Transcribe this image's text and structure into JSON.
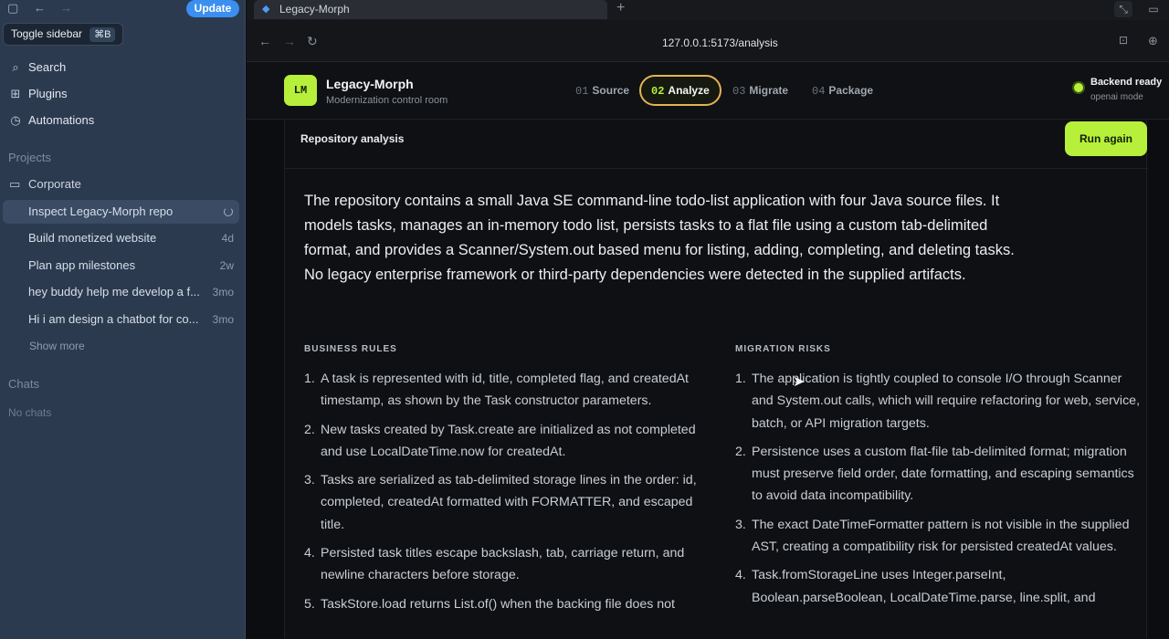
{
  "sidebar": {
    "update_label": "Update",
    "tooltip": {
      "label": "Toggle sidebar",
      "shortcut": "⌘B"
    },
    "nav": [
      {
        "icon": "search-icon",
        "label": "Search"
      },
      {
        "icon": "plugins-icon",
        "label": "Plugins"
      },
      {
        "icon": "clock-icon",
        "label": "Automations"
      }
    ],
    "projects_label": "Projects",
    "folder": {
      "icon": "folder-icon",
      "label": "Corporate"
    },
    "threads": [
      {
        "title": "Inspect Legacy-Morph repo",
        "meta": "",
        "active": true
      },
      {
        "title": "Build monetized website",
        "meta": "4d"
      },
      {
        "title": "Plan app milestones",
        "meta": "2w"
      },
      {
        "title": "hey buddy help me develop a f...",
        "meta": "3mo"
      },
      {
        "title": "Hi i am design a chatbot for co...",
        "meta": "3mo"
      }
    ],
    "show_more": "Show more",
    "chats_label": "Chats",
    "no_chats": "No chats"
  },
  "browser": {
    "tab_title": "Legacy-Morph",
    "url": "127.0.0.1:5173/analysis"
  },
  "header": {
    "logo": "LM",
    "title": "Legacy-Morph",
    "subtitle": "Modernization control room",
    "steps": [
      {
        "num": "01",
        "label": "Source"
      },
      {
        "num": "02",
        "label": "Analyze",
        "active": true
      },
      {
        "num": "03",
        "label": "Migrate"
      },
      {
        "num": "04",
        "label": "Package"
      }
    ],
    "status": {
      "title": "Backend ready",
      "subtitle": "openai mode",
      "color": "#b7f03a"
    }
  },
  "analysis": {
    "title": "Repository analysis",
    "run_again": "Run again",
    "summary": "The repository contains a small Java SE command-line todo-list application with four Java source files. It models tasks, manages an in-memory todo list, persists tasks to a flat file using a custom tab-delimited format, and provides a Scanner/System.out based menu for listing, adding, completing, and deleting tasks. No legacy enterprise framework or third-party dependencies were detected in the supplied artifacts.",
    "business_rules": {
      "heading": "BUSINESS RULES",
      "items": [
        "A task is represented with id, title, completed flag, and createdAt timestamp, as shown by the Task constructor parameters.",
        "New tasks created by Task.create are initialized as not completed and use LocalDateTime.now for createdAt.",
        "Tasks are serialized as tab-delimited storage lines in the order: id, completed, createdAt formatted with FORMATTER, and escaped title.",
        "Persisted task titles escape backslash, tab, carriage return, and newline characters before storage.",
        "TaskStore.load returns List.of() when the backing file does not"
      ]
    },
    "migration_risks": {
      "heading": "MIGRATION RISKS",
      "items": [
        "The application is tightly coupled to console I/O through Scanner and System.out calls, which will require refactoring for web, service, batch, or API migration targets.",
        "Persistence uses a custom flat-file tab-delimited format; migration must preserve field order, date formatting, and escaping semantics to avoid data incompatibility.",
        "The exact DateTimeFormatter pattern is not visible in the supplied AST, creating a compatibility risk for persisted createdAt values.",
        "Task.fromStorageLine uses Integer.parseInt, Boolean.parseBoolean, LocalDateTime.parse, line.split, and"
      ]
    }
  }
}
